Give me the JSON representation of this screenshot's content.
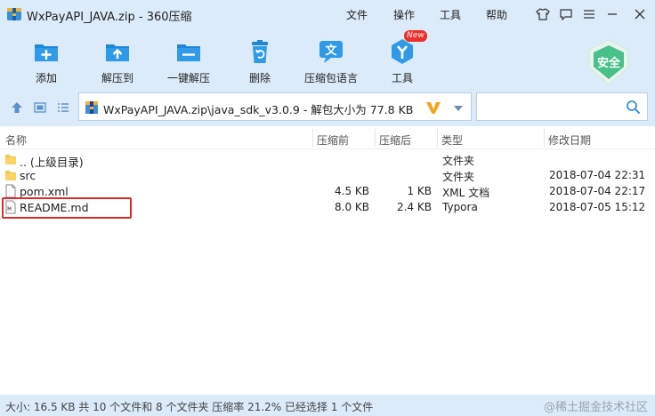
{
  "window": {
    "title": "WxPayAPI_JAVA.zip - 360压缩",
    "menu": [
      "文件",
      "操作",
      "工具",
      "帮助"
    ]
  },
  "toolbar": {
    "items": [
      {
        "label": "添加",
        "icon": "add-icon"
      },
      {
        "label": "解压到",
        "icon": "extract-to-icon"
      },
      {
        "label": "一键解压",
        "icon": "one-click-extract-icon"
      },
      {
        "label": "删除",
        "icon": "trash-icon"
      },
      {
        "label": "压缩包语言",
        "icon": "language-icon"
      },
      {
        "label": "工具",
        "icon": "tools-icon"
      }
    ],
    "new_badge": "New",
    "safe_label": "安全"
  },
  "address": {
    "path": "WxPayAPI_JAVA.zip\\java_sdk_v3.0.9 - 解包大小为 77.8 KB",
    "search_placeholder": ""
  },
  "columns": {
    "name": "名称",
    "compressed_before": "压缩前",
    "compressed_after": "压缩后",
    "type": "类型",
    "modified": "修改日期"
  },
  "files": [
    {
      "name": ".. (上级目录)",
      "size_before": "",
      "size_after": "",
      "type": "文件夹",
      "date": "",
      "kind": "folder"
    },
    {
      "name": "src",
      "size_before": "",
      "size_after": "",
      "type": "文件夹",
      "date": "2018-07-04 22:31",
      "kind": "folder"
    },
    {
      "name": "pom.xml",
      "size_before": "4.5 KB",
      "size_after": "1 KB",
      "type": "XML 文档",
      "date": "2018-07-04 22:17",
      "kind": "file"
    },
    {
      "name": "README.md",
      "size_before": "8.0 KB",
      "size_after": "2.4 KB",
      "type": "Typora",
      "date": "2018-07-05 15:12",
      "kind": "file"
    }
  ],
  "status": {
    "text": "大小: 16.5 KB 共 10 个文件和 8 个文件夹 压缩率 21.2% 已经选择 1 个文件",
    "watermark": "@稀土掘金技术社区"
  },
  "colors": {
    "chrome": "#dcebfa",
    "accent": "#1e88d8",
    "highlight": "#e02a2a",
    "safe": "#48c08a"
  }
}
